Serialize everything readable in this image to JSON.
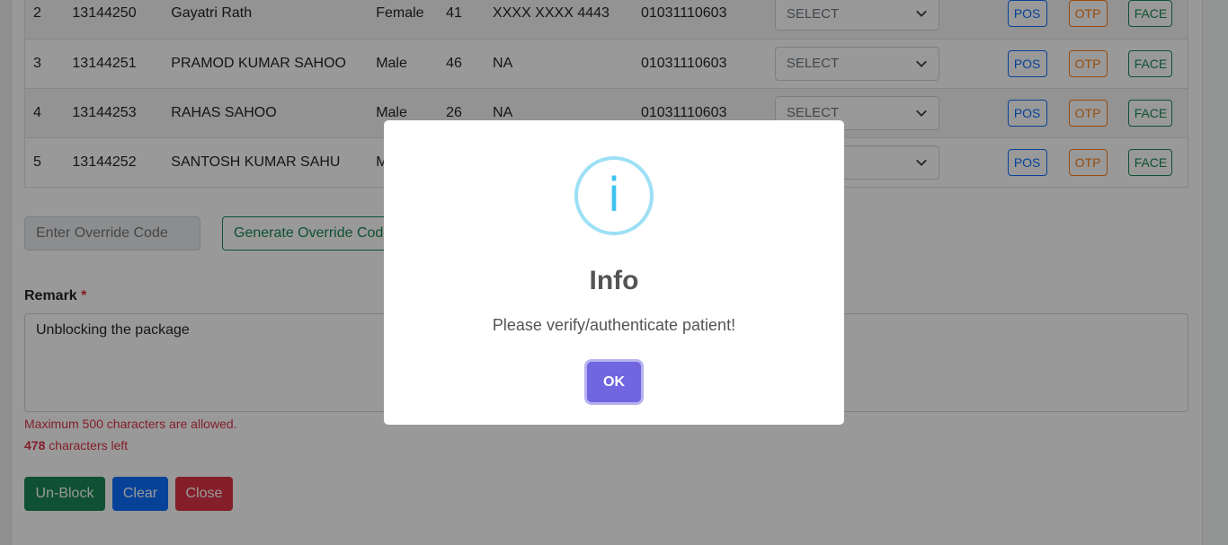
{
  "patients": {
    "rows": [
      {
        "sl": "2",
        "id": "13144250",
        "name": "Gayatri Rath",
        "gender": "Female",
        "age": "41",
        "aadhaar": "XXXX XXXX 4443",
        "ration": "01031110603",
        "select": "SELECT",
        "pos": "POS",
        "otp": "OTP",
        "face": "FACE"
      },
      {
        "sl": "3",
        "id": "13144251",
        "name": "PRAMOD KUMAR SAHOO",
        "gender": "Male",
        "age": "46",
        "aadhaar": "NA",
        "ration": "01031110603",
        "select": "SELECT",
        "pos": "POS",
        "otp": "OTP",
        "face": "FACE"
      },
      {
        "sl": "4",
        "id": "13144253",
        "name": "RAHAS SAHOO",
        "gender": "Male",
        "age": "26",
        "aadhaar": "NA",
        "ration": "01031110603",
        "select": "SELECT",
        "pos": "POS",
        "otp": "OTP",
        "face": "FACE"
      },
      {
        "sl": "5",
        "id": "13144252",
        "name": "SANTOSH KUMAR SAHU",
        "gender": "M",
        "age": "",
        "aadhaar": "",
        "ration": "",
        "select": "",
        "pos": "POS",
        "otp": "OTP",
        "face": "FACE"
      }
    ]
  },
  "override": {
    "placeholder": "Enter Override Code",
    "generate_label": "Generate Override Code"
  },
  "remark": {
    "label": "Remark",
    "required_mark": "*",
    "value": "Unblocking the package",
    "max_hint": "Maximum 500 characters are allowed.",
    "chars_left": "478",
    "chars_left_suffix": " characters left"
  },
  "actions": {
    "unblock": "Un-Block",
    "clear": "Clear",
    "close": "Close"
  },
  "dialog": {
    "icon": "i",
    "title": "Info",
    "message": "Please verify/authenticate patient!",
    "ok": "OK"
  }
}
